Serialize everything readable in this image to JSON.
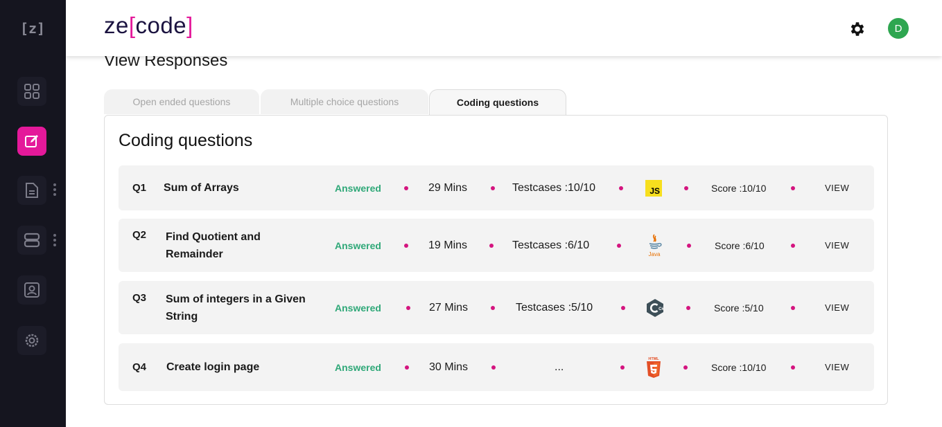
{
  "app": {
    "sidebar_logo": "[z]",
    "brand_prefix": "ze",
    "brand_open": "[",
    "brand_word": "code",
    "brand_close": "]",
    "avatar_initial": "D",
    "accent_color": "#e4199a",
    "avatar_color": "#2ea650"
  },
  "page": {
    "title": "View Responses"
  },
  "tabs": [
    {
      "label": "Open ended questions",
      "active": false
    },
    {
      "label": "Multiple choice questions",
      "active": false
    },
    {
      "label": "Coding questions",
      "active": true
    }
  ],
  "panel": {
    "title": "Coding questions"
  },
  "questions": [
    {
      "num": "Q1",
      "title": "Sum of Arrays",
      "status": "Answered",
      "time": "29 Mins",
      "testcases": "Testcases :10/10",
      "language_icon": "javascript-icon",
      "language_badge": "JS",
      "score": "Score :10/10",
      "action": "VIEW"
    },
    {
      "num": "Q2",
      "title_line1": "Find Quotient and",
      "title_line2": "Remainder",
      "status": "Answered",
      "time": "19 Mins",
      "testcases": "Testcases :6/10",
      "language_icon": "java-icon",
      "language_badge": "Java",
      "score": "Score :6/10",
      "action": "VIEW"
    },
    {
      "num": "Q3",
      "title_line1": "Sum of integers in a Given",
      "title_line2": "String",
      "status": "Answered",
      "time": "27 Mins",
      "testcases": "Testcases :5/10",
      "language_icon": "csharp-icon",
      "language_badge": "C#",
      "score": "Score :5/10",
      "action": "VIEW"
    },
    {
      "num": "Q4",
      "title": "Create login page",
      "status": "Answered",
      "time": "30 Mins",
      "testcases": "...",
      "language_icon": "html5-icon",
      "language_badge": "HTML",
      "score": "Score :10/10",
      "action": "VIEW"
    }
  ],
  "colors": {
    "answered": "#2fa878",
    "separator_dot": "#d4147f",
    "sidebar_bg": "#15151f"
  }
}
